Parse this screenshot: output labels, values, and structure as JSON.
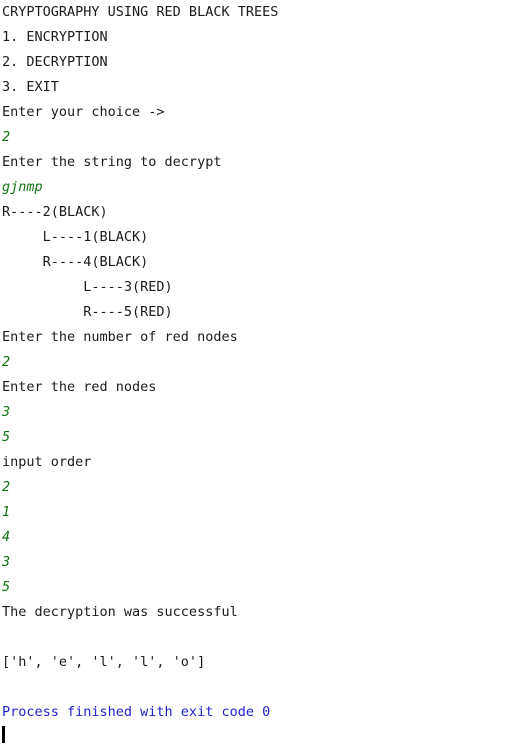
{
  "console": {
    "background_color": "#ffffff",
    "output_color": "#1b1b1b",
    "input_color": "#127312",
    "system_color": "#2222cc",
    "cursor_color": "#000000",
    "lines": [
      {
        "text": "CRYPTOGRAPHY USING RED BLACK TREES",
        "kind": "out"
      },
      {
        "text": "1. ENCRYPTION",
        "kind": "out"
      },
      {
        "text": "2. DECRYPTION",
        "kind": "out"
      },
      {
        "text": "3. EXIT",
        "kind": "out"
      },
      {
        "text": "Enter your choice ->",
        "kind": "out"
      },
      {
        "text": "2",
        "kind": "in"
      },
      {
        "text": "Enter the string to decrypt",
        "kind": "out"
      },
      {
        "text": "gjnmp",
        "kind": "in"
      },
      {
        "text": "R----2(BLACK)",
        "kind": "out"
      },
      {
        "text": "     L----1(BLACK)",
        "kind": "out"
      },
      {
        "text": "     R----4(BLACK)",
        "kind": "out"
      },
      {
        "text": "          L----3(RED)",
        "kind": "out"
      },
      {
        "text": "          R----5(RED)",
        "kind": "out"
      },
      {
        "text": "Enter the number of red nodes",
        "kind": "out"
      },
      {
        "text": "2",
        "kind": "in"
      },
      {
        "text": "Enter the red nodes",
        "kind": "out"
      },
      {
        "text": "3",
        "kind": "in"
      },
      {
        "text": "5",
        "kind": "in"
      },
      {
        "text": "input order",
        "kind": "out"
      },
      {
        "text": "2",
        "kind": "in"
      },
      {
        "text": "1",
        "kind": "in"
      },
      {
        "text": "4",
        "kind": "in"
      },
      {
        "text": "3",
        "kind": "in"
      },
      {
        "text": "5",
        "kind": "in"
      },
      {
        "text": "The decryption was successful",
        "kind": "out"
      },
      {
        "text": " ",
        "kind": "blank"
      },
      {
        "text": "['h', 'e', 'l', 'l', 'o']",
        "kind": "out"
      },
      {
        "text": " ",
        "kind": "blank"
      },
      {
        "text": "Process finished with exit code 0",
        "kind": "sys"
      }
    ]
  }
}
